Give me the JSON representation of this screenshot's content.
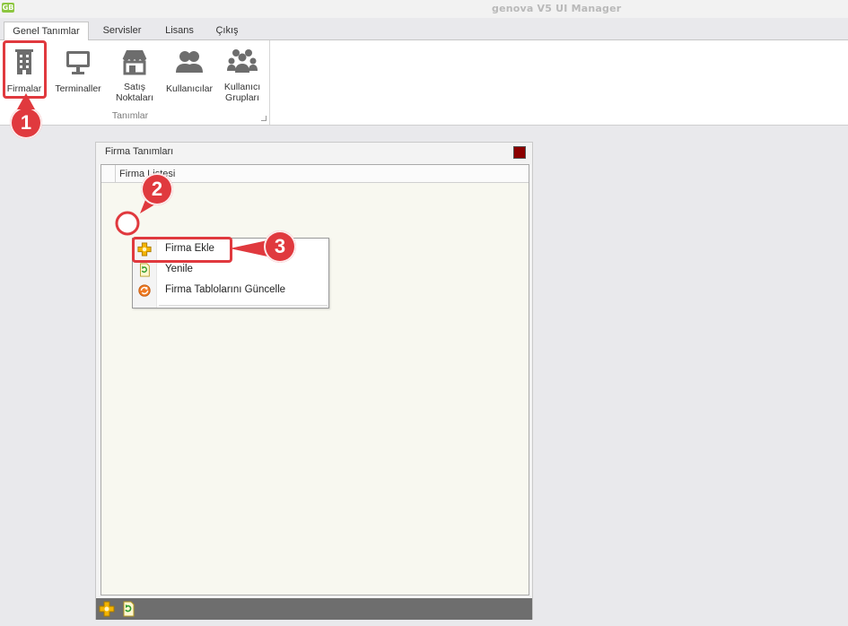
{
  "window": {
    "title": "genova V5 UI Manager",
    "logo_text": "GB"
  },
  "tabs": [
    {
      "label": "Genel Tanımlar",
      "active": true
    },
    {
      "label": "Servisler",
      "active": false
    },
    {
      "label": "Lisans",
      "active": false
    },
    {
      "label": "Çıkış",
      "active": false
    }
  ],
  "ribbon": {
    "group_label": "Tanımlar",
    "buttons": [
      {
        "label": "Firmalar",
        "icon": "building-icon"
      },
      {
        "label": "Terminaller",
        "icon": "monitor-icon"
      },
      {
        "label": "Satış Noktaları",
        "icon": "store-icon"
      },
      {
        "label": "Kullanıcılar",
        "icon": "users-icon"
      },
      {
        "label": "Kullanıcı Grupları",
        "icon": "user-group-icon"
      }
    ]
  },
  "panel": {
    "title": "Firma Tanımları",
    "grid_column": "Firma Listesi"
  },
  "context_menu": {
    "items": [
      {
        "label": "Firma Ekle",
        "icon": "add-icon"
      },
      {
        "label": "Yenile",
        "icon": "refresh-icon"
      },
      {
        "label": "Firma Tablolarını Güncelle",
        "icon": "update-tables-icon"
      }
    ]
  },
  "annotations": {
    "step1": "1",
    "step2": "2",
    "step3": "3",
    "color": "#e0393e"
  },
  "colors": {
    "close_button": "#8b0000",
    "footer": "#6e6e6e",
    "grid_background": "#f8f8f0"
  }
}
